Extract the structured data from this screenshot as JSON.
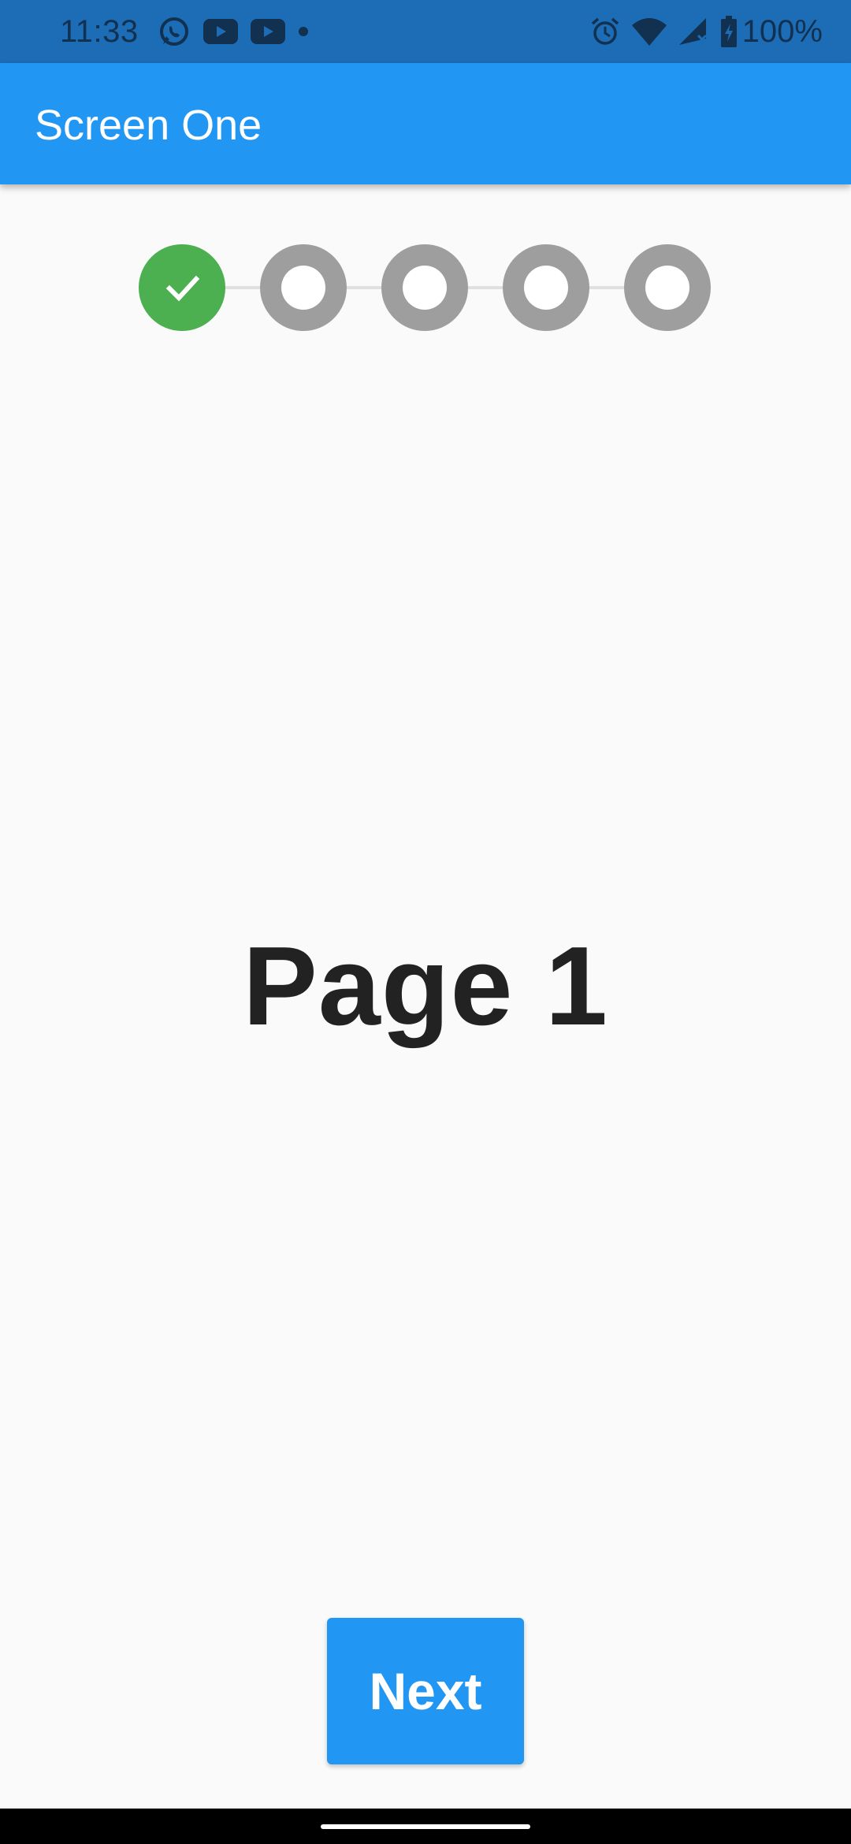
{
  "status_bar": {
    "time": "11:33",
    "left_icons": [
      "whatsapp-icon",
      "youtube-icon",
      "youtube-icon",
      "notification-dot-icon"
    ],
    "right_icons": [
      "alarm-icon",
      "wifi-icon",
      "signal-icon",
      "battery-charging-icon"
    ],
    "battery": "100%",
    "background": "#1c6db6"
  },
  "app_bar": {
    "title": "Screen One",
    "color": "#2196f3"
  },
  "stepper": {
    "steps": [
      {
        "state": "completed",
        "icon": "check-icon"
      },
      {
        "state": "pending"
      },
      {
        "state": "pending"
      },
      {
        "state": "pending"
      },
      {
        "state": "pending"
      }
    ],
    "completed_color": "#4caf50",
    "pending_color": "#9e9e9e"
  },
  "main": {
    "heading": "Page 1"
  },
  "actions": {
    "next_label": "Next"
  }
}
